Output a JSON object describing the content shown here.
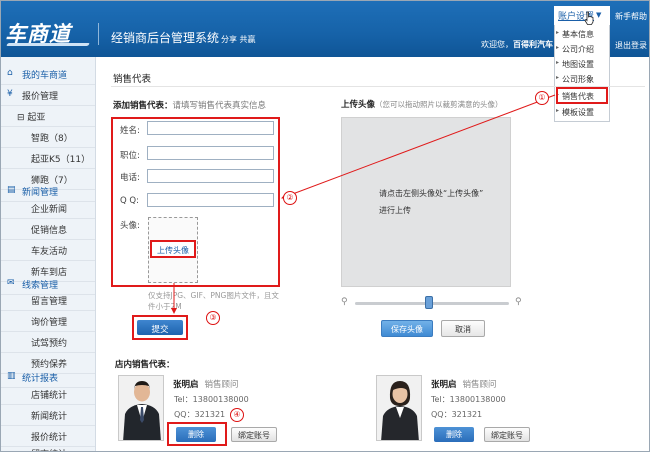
{
  "header": {
    "logo": "车商道",
    "system_title": "经销商后台管理系统",
    "system_subtitle": "分享 共赢",
    "welcome_prefix": "欢迎您，",
    "welcome_user": "百得利汽车",
    "account_menu_label": "账户设置",
    "help_label": "新手帮助",
    "logout_label": "退出登录"
  },
  "account_menu": {
    "items": [
      "基本信息",
      "公司介绍",
      "地图设置",
      "公司形象",
      "销售代表",
      "模板设置"
    ],
    "selected": "销售代表"
  },
  "sidebar": {
    "items": [
      {
        "label": "我的车商道",
        "type": "head",
        "icon": "home-icon"
      },
      {
        "label": "报价管理",
        "type": "head",
        "icon": "yen-icon"
      },
      {
        "label": "起亚",
        "type": "sub",
        "prefix": "⊟"
      },
      {
        "label": "智跑（8）",
        "type": "sub2"
      },
      {
        "label": "起亚K5（11）",
        "type": "sub2"
      },
      {
        "label": "狮跑（7）",
        "type": "sub2"
      },
      {
        "label": "新闻管理",
        "type": "head",
        "icon": "news-icon"
      },
      {
        "label": "企业新闻",
        "type": "sub2"
      },
      {
        "label": "促销信息",
        "type": "sub2"
      },
      {
        "label": "车友活动",
        "type": "sub2"
      },
      {
        "label": "新车到店",
        "type": "sub2"
      },
      {
        "label": "线索管理",
        "type": "head",
        "icon": "chat-icon"
      },
      {
        "label": "留言管理",
        "type": "sub2"
      },
      {
        "label": "询价管理",
        "type": "sub2"
      },
      {
        "label": "试驾预约",
        "type": "sub2"
      },
      {
        "label": "预约保养",
        "type": "sub2"
      },
      {
        "label": "统计报表",
        "type": "head",
        "icon": "stats-icon"
      },
      {
        "label": "店铺统计",
        "type": "sub2"
      },
      {
        "label": "新闻统计",
        "type": "sub2"
      },
      {
        "label": "报价统计",
        "type": "sub2"
      },
      {
        "label": "留言统计",
        "type": "sub2"
      }
    ]
  },
  "main": {
    "page_title": "销售代表",
    "add_section_label": "添加销售代表：",
    "add_section_hint": "请填写销售代表真实信息",
    "form": {
      "name_label": "姓名:",
      "position_label": "职位:",
      "phone_label": "电话:",
      "qq_label": "Q Q:",
      "avatar_label": "头像:",
      "upload_button": "上传头像",
      "upload_note": "仅支持JPG、GIF、PNG图片文件，且文件小于2M",
      "submit_button": "提交"
    },
    "avatar_panel": {
      "title": "上传头像",
      "title_hint": "（您可以拖动照片以裁剪满意的头像）",
      "hint_line1": "请点击左侧头像处“上传头像”",
      "hint_line2": "进行上传",
      "save_button": "保存头像",
      "cancel_button": "取消",
      "zoom_level": 0.47
    },
    "store_section_label": "店内销售代表：",
    "reps": [
      {
        "name": "张明启",
        "title": "销售顾问",
        "tel": "Tel：13800138000",
        "qq": "QQ：321321",
        "delete_button": "删除",
        "bind_button": "绑定账号"
      },
      {
        "name": "张明启",
        "title": "销售顾问",
        "tel": "Tel：13800138000",
        "qq": "QQ：321321",
        "delete_button": "删除",
        "bind_button": "绑定账号"
      }
    ]
  },
  "callouts": [
    "①",
    "②",
    "③",
    "④"
  ],
  "colors": {
    "header_blue": "#1662a8",
    "highlight_red": "#e01a1a",
    "link_blue": "#1a5fa8"
  }
}
